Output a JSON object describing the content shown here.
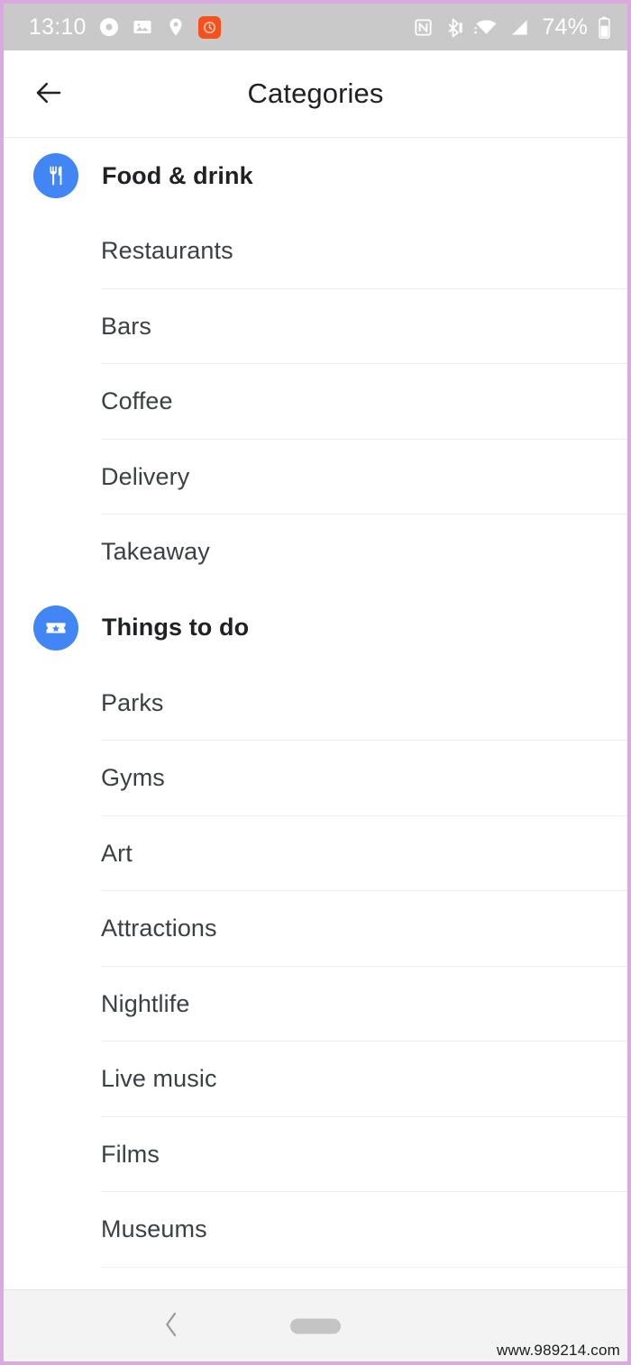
{
  "status_bar": {
    "time": "13:10",
    "battery_percent": "74%",
    "left_icons": [
      {
        "name": "record-circle-icon"
      },
      {
        "name": "photo-image-icon"
      },
      {
        "name": "location-pin-icon"
      },
      {
        "name": "orange-app-notification-icon",
        "color": "#f4511e"
      }
    ],
    "right_icons": [
      {
        "name": "nfc-icon"
      },
      {
        "name": "bluetooth-icon"
      },
      {
        "name": "wifi-icon"
      },
      {
        "name": "cellular-signal-icon"
      },
      {
        "name": "battery-icon"
      }
    ],
    "background_color": "#c9c9c9",
    "foreground_color": "#ffffff"
  },
  "app_bar": {
    "title": "Categories",
    "back_icon": "arrow-left-icon"
  },
  "theme": {
    "accent_blue": "#4285f4",
    "text_primary": "#202124",
    "text_secondary": "#3c4043",
    "divider": "#ededed",
    "frame_border": "#d9a9e0"
  },
  "sections": [
    {
      "label": "Food & drink",
      "icon": "fork-knife-icon",
      "icon_color": "#4285f4",
      "items": [
        {
          "label": "Restaurants"
        },
        {
          "label": "Bars"
        },
        {
          "label": "Coffee"
        },
        {
          "label": "Delivery"
        },
        {
          "label": "Takeaway"
        }
      ]
    },
    {
      "label": "Things to do",
      "icon": "ticket-star-icon",
      "icon_color": "#4285f4",
      "items": [
        {
          "label": "Parks"
        },
        {
          "label": "Gyms"
        },
        {
          "label": "Art"
        },
        {
          "label": "Attractions"
        },
        {
          "label": "Nightlife"
        },
        {
          "label": "Live music"
        },
        {
          "label": "Films"
        },
        {
          "label": "Museums"
        }
      ]
    }
  ],
  "nav_bar": {
    "back_icon": "chevron-left-icon",
    "home_indicator": "home-pill-indicator",
    "background_color": "#f3f3f3"
  },
  "watermark": {
    "text": "www.989214.com"
  }
}
